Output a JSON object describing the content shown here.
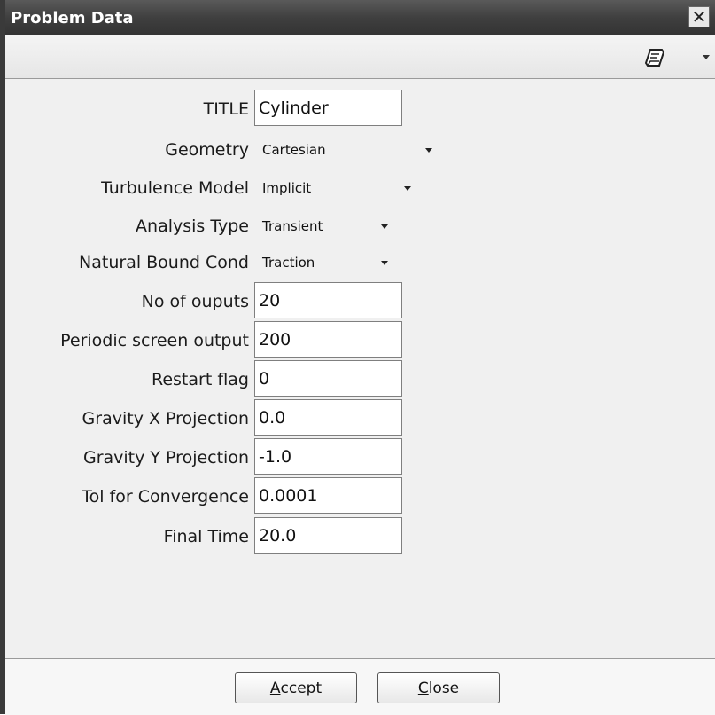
{
  "window": {
    "title": "Problem Data",
    "close_glyph": "✕"
  },
  "toolbar": {
    "icon": "notepad-icon",
    "menu_caret": "chevron-down-icon"
  },
  "fields": [
    {
      "label": "TITLE",
      "type": "text",
      "value": "Cylinder"
    },
    {
      "label": "Geometry",
      "type": "select",
      "value": "Cartesian"
    },
    {
      "label": "Turbulence Model",
      "type": "select",
      "value": "Implicit"
    },
    {
      "label": "Analysis Type",
      "type": "select",
      "value": "Transient"
    },
    {
      "label": "Natural Bound Cond",
      "type": "select",
      "value": "Traction"
    },
    {
      "label": "No of ouputs",
      "type": "text",
      "value": "20"
    },
    {
      "label": "Periodic screen output",
      "type": "text",
      "value": "200"
    },
    {
      "label": "Restart flag",
      "type": "text",
      "value": "0"
    },
    {
      "label": "Gravity X Projection",
      "type": "text",
      "value": "0.0"
    },
    {
      "label": "Gravity Y Projection",
      "type": "text",
      "value": "-1.0"
    },
    {
      "label": "Tol for Convergence",
      "type": "text",
      "value": "0.0001"
    },
    {
      "label": "Final Time",
      "type": "text",
      "value": "20.0"
    }
  ],
  "buttons": {
    "accept": {
      "mnemonic": "A",
      "rest": "ccept"
    },
    "close": {
      "mnemonic": "C",
      "rest": "lose"
    }
  }
}
